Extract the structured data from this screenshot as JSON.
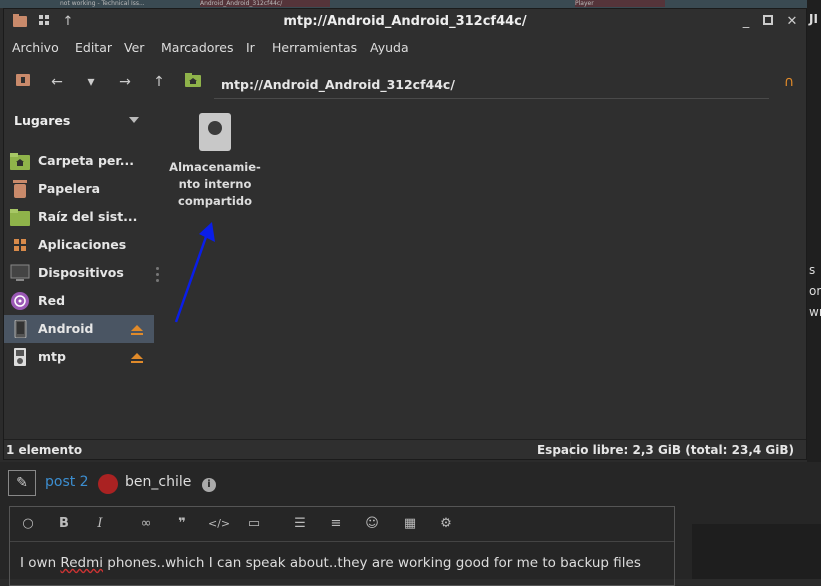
{
  "background": {
    "tabs": [
      "not working - Technical Iss...",
      "Android_Android_312cf44c/",
      "Player"
    ],
    "right_text": [
      "JI",
      "s",
      "on",
      "wn"
    ]
  },
  "window": {
    "title": "mtp://Android_Android_312cf44c/",
    "menu": [
      "Archivo",
      "Editar",
      "Ver",
      "Marcadores",
      "Ir",
      "Herramientas",
      "Ayuda"
    ],
    "location": "mtp://Android_Android_312cf44c/",
    "sidebar": {
      "header": "Lugares",
      "items": [
        {
          "label": "Carpeta per...",
          "icon": "home-folder-icon"
        },
        {
          "label": "Papelera",
          "icon": "trash-icon"
        },
        {
          "label": "Raíz del sist...",
          "icon": "folder-icon"
        },
        {
          "label": "Aplicaciones",
          "icon": "apps-icon"
        },
        {
          "label": "Dispositivos",
          "icon": "monitor-icon"
        },
        {
          "label": "Red",
          "icon": "network-icon"
        },
        {
          "label": "Android",
          "icon": "phone-icon",
          "selected": true
        },
        {
          "label": "mtp",
          "icon": "media-player-icon"
        }
      ]
    },
    "files": [
      {
        "name": "Almacenamie-\nnto interno\ncompartido",
        "icon": "drive-icon"
      }
    ],
    "status_left": "1 elemento",
    "status_right": "Espacio libre: 2,3 GiB (total: 23,4 GiB)"
  },
  "forum": {
    "post_link": "post 2",
    "username": "ben_chile",
    "editor_text_pre": "I own ",
    "editor_text_spell": "Redmi",
    "editor_text_post": " phones..which I can speak about..they are working good for me to backup files"
  },
  "colors": {
    "accent": "#3c8ed0",
    "selected": "#4a5563",
    "folder": "#8fb34a"
  }
}
